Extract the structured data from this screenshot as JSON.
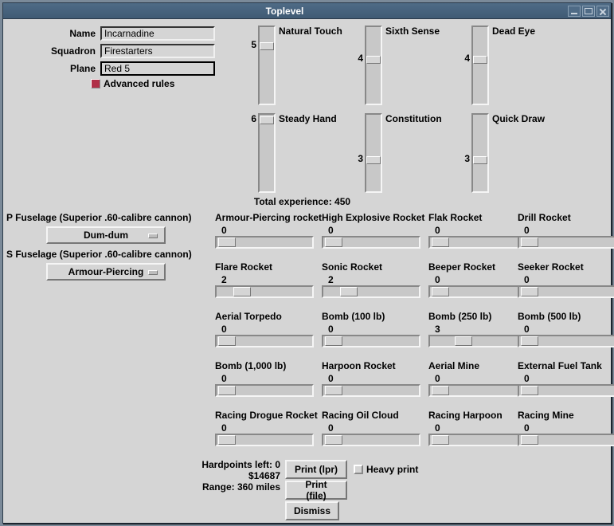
{
  "window": {
    "title": "Toplevel"
  },
  "form": {
    "name_label": "Name",
    "name_value": "Incarnadine",
    "squadron_label": "Squadron",
    "squadron_value": "Firestarters",
    "plane_label": "Plane",
    "plane_value": "Red 5",
    "adv_label": "Advanced rules",
    "adv_checked": true
  },
  "skills_row1": [
    {
      "label": "Natural Touch",
      "value": 5,
      "max": 6
    },
    {
      "label": "Sixth Sense",
      "value": 4,
      "max": 6
    },
    {
      "label": "Dead Eye",
      "value": 4,
      "max": 6
    }
  ],
  "skills_row2": [
    {
      "label": "Steady Hand",
      "value": 6,
      "max": 6
    },
    {
      "label": "Constitution",
      "value": 3,
      "max": 6
    },
    {
      "label": "Quick Draw",
      "value": 3,
      "max": 6
    }
  ],
  "total_exp": "Total experience: 450",
  "fuselage": {
    "p_label": "P Fuselage (Superior .60-calibre cannon)",
    "p_option": "Dum-dum",
    "s_label": "S Fuselage (Superior .60-calibre cannon)",
    "s_option": "Armour-Piercing"
  },
  "hardpoints": [
    [
      {
        "label": "Armour-Piercing rocket",
        "value": 0
      },
      {
        "label": "High Explosive Rocket",
        "value": 0
      },
      {
        "label": "Flak Rocket",
        "value": 0
      },
      {
        "label": "Drill Rocket",
        "value": 0
      }
    ],
    [
      {
        "label": "Flare Rocket",
        "value": 2
      },
      {
        "label": "Sonic Rocket",
        "value": 2
      },
      {
        "label": "Beeper Rocket",
        "value": 0
      },
      {
        "label": "Seeker Rocket",
        "value": 0
      }
    ],
    [
      {
        "label": "Aerial Torpedo",
        "value": 0
      },
      {
        "label": "Bomb (100 lb)",
        "value": 0
      },
      {
        "label": "Bomb (250 lb)",
        "value": 3
      },
      {
        "label": "Bomb (500 lb)",
        "value": 0
      }
    ],
    [
      {
        "label": "Bomb (1,000 lb)",
        "value": 0
      },
      {
        "label": "Harpoon Rocket",
        "value": 0
      },
      {
        "label": "Aerial Mine",
        "value": 0
      },
      {
        "label": "External Fuel Tank",
        "value": 0
      }
    ],
    [
      {
        "label": "Racing Drogue Rocket",
        "value": 0
      },
      {
        "label": "Racing Oil Cloud",
        "value": 0
      },
      {
        "label": "Racing Harpoon",
        "value": 0
      },
      {
        "label": "Racing Mine",
        "value": 0
      }
    ]
  ],
  "bottom": {
    "hardpoints_left": "Hardpoints left: 0",
    "cost": "$14687",
    "range": "Range: 360 miles",
    "print_lpr": "Print (lpr)",
    "print_file": "Print (file)",
    "heavy_print": "Heavy print",
    "dismiss": "Dismiss"
  }
}
